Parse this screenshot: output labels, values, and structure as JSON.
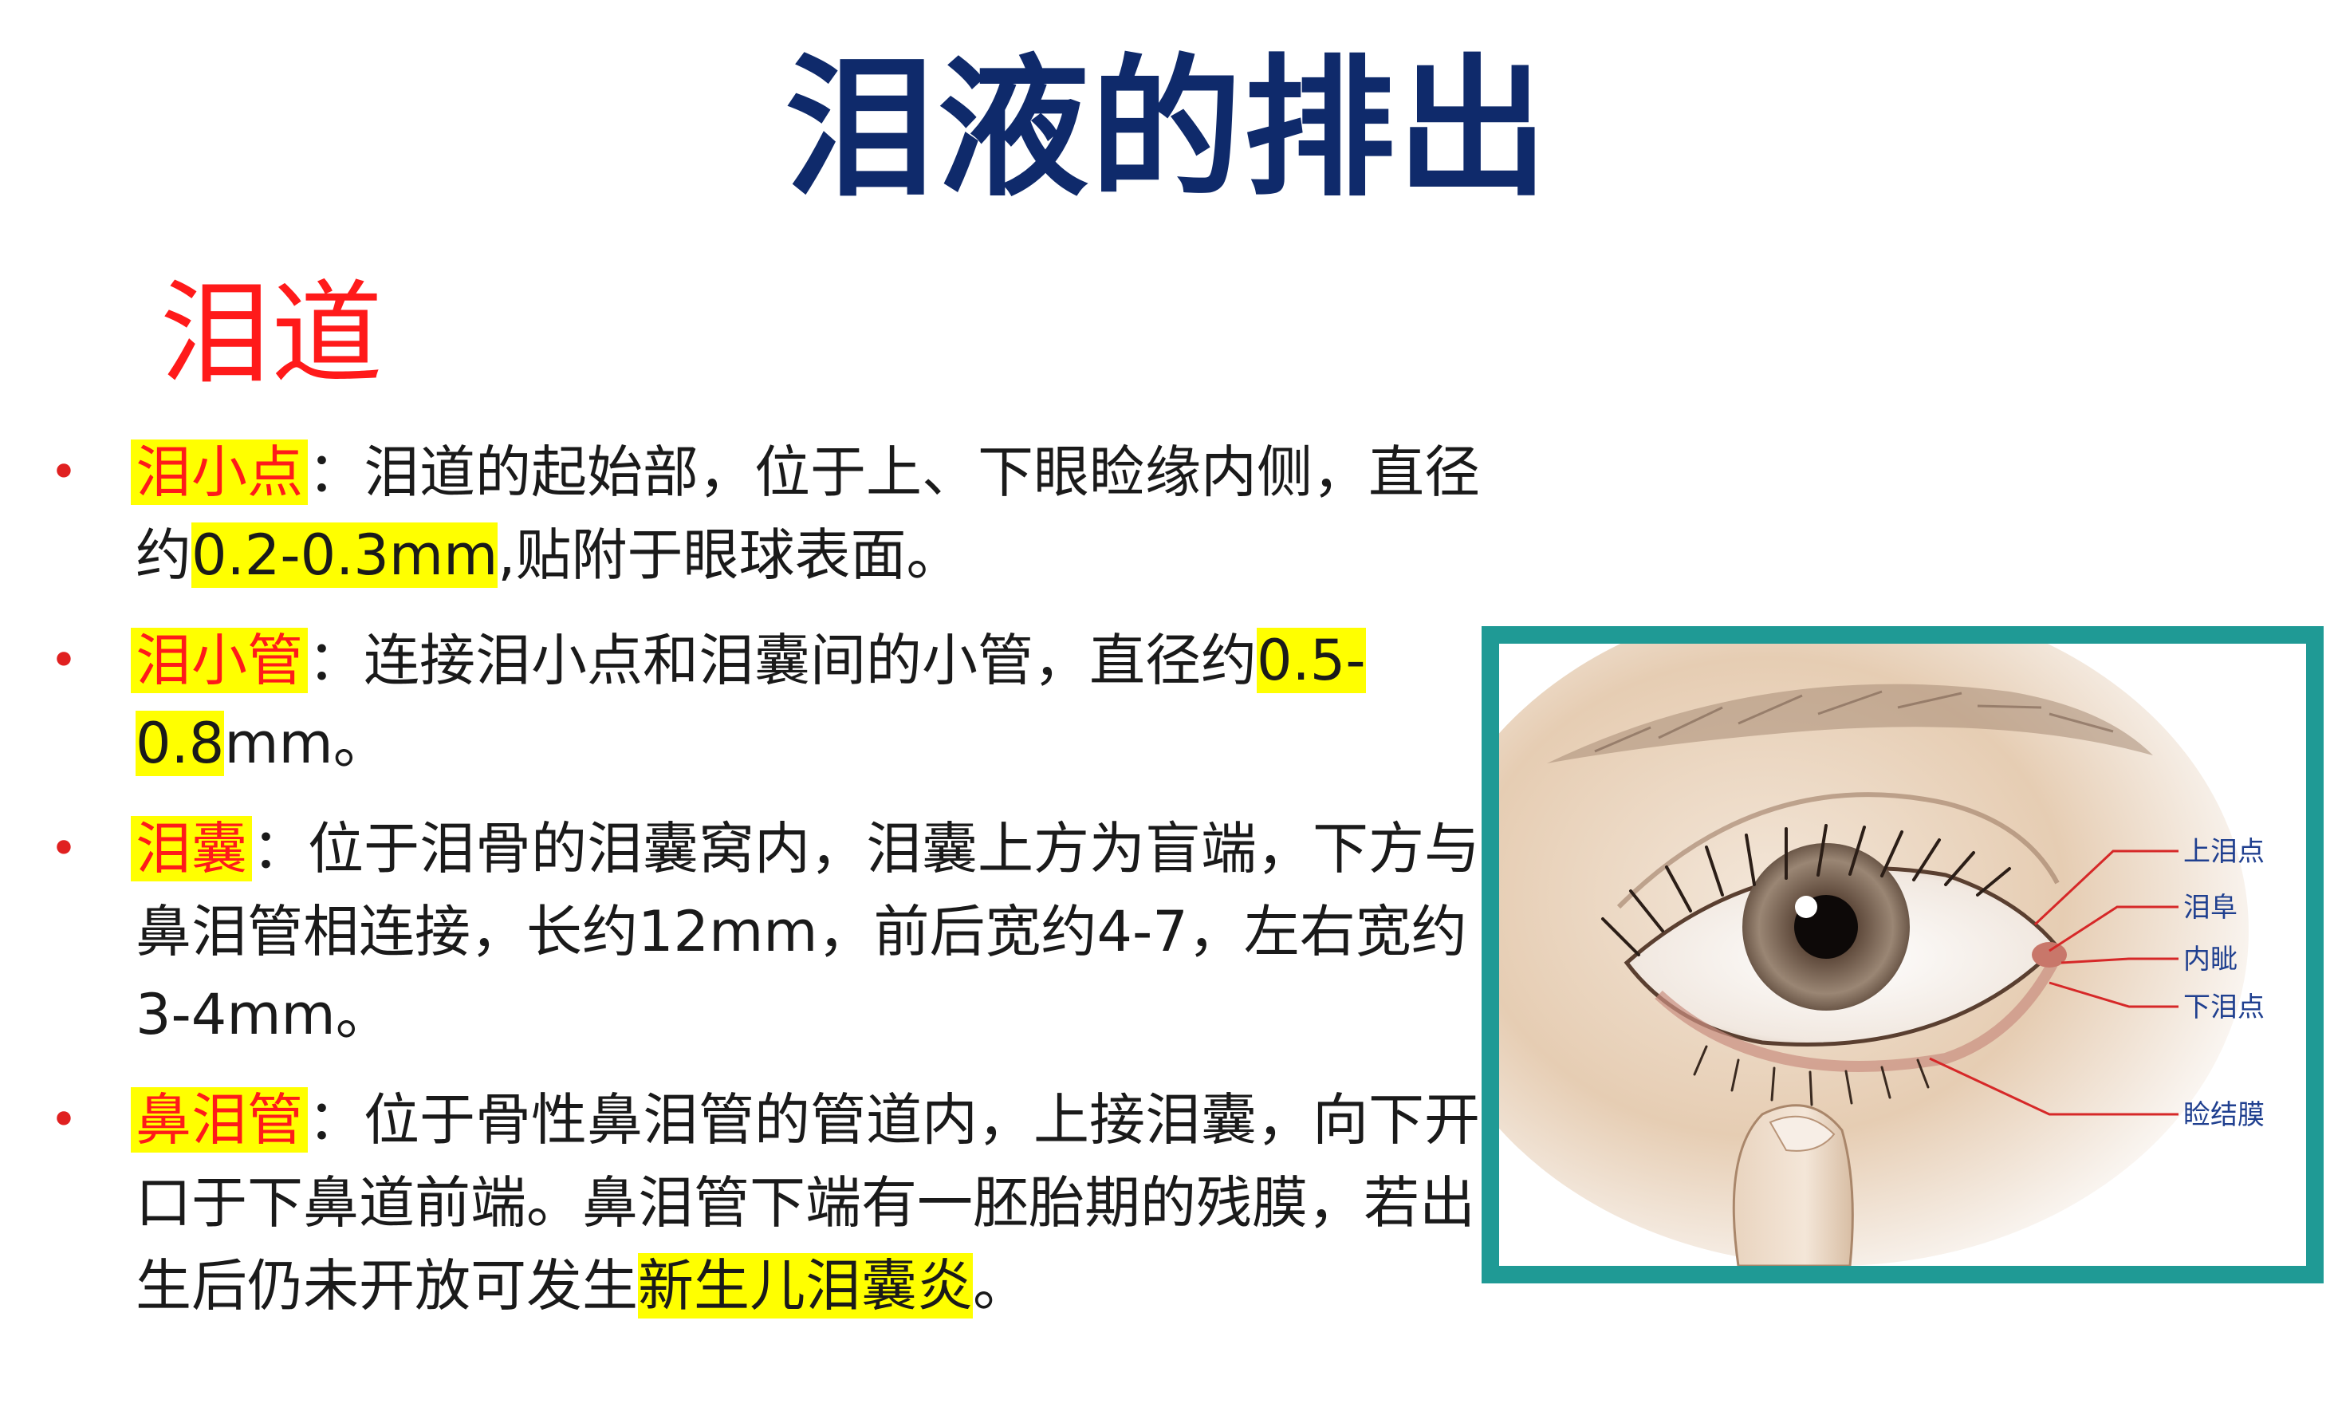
{
  "title": "泪液的排出",
  "section_heading": "泪道",
  "bullets": [
    {
      "term": "泪小点",
      "sep": "：",
      "text_a": "泪道的起始部，位于上、下眼睑缘内侧，直径约",
      "highlight": "0.2-0.3mm",
      "text_b": ",贴附于眼球表面。"
    },
    {
      "term": "泪小管",
      "sep": "：",
      "text_a": "连接泪小点和泪囊间的小管，直径约",
      "highlight": "0.5-0.8",
      "text_b": "mm。"
    },
    {
      "term": "泪囊",
      "sep": "：",
      "text_a": "位于泪骨的泪囊窝内，泪囊上方为盲端，下方与鼻泪管相连接，长约12mm，前后宽约4-7，左右宽约3-4mm。",
      "highlight": "",
      "text_b": ""
    },
    {
      "term": "鼻泪管",
      "sep": "：",
      "text_a": "位于骨性鼻泪管的管道内，上接泪囊，向下开口于下鼻道前端。鼻泪管下端有一胚胎期的残膜，若出生后仍未开放可发生",
      "highlight": "新生儿泪囊炎",
      "text_b": "。"
    }
  ],
  "figure": {
    "labels": [
      "上泪点",
      "泪阜",
      "内眦",
      "下泪点",
      "睑结膜"
    ]
  },
  "colors": {
    "title": "#0f2a6b",
    "heading": "#ff1a1a",
    "highlight": "#ffff00",
    "frame": "#1f9a95",
    "leader_line": "#d62828"
  }
}
